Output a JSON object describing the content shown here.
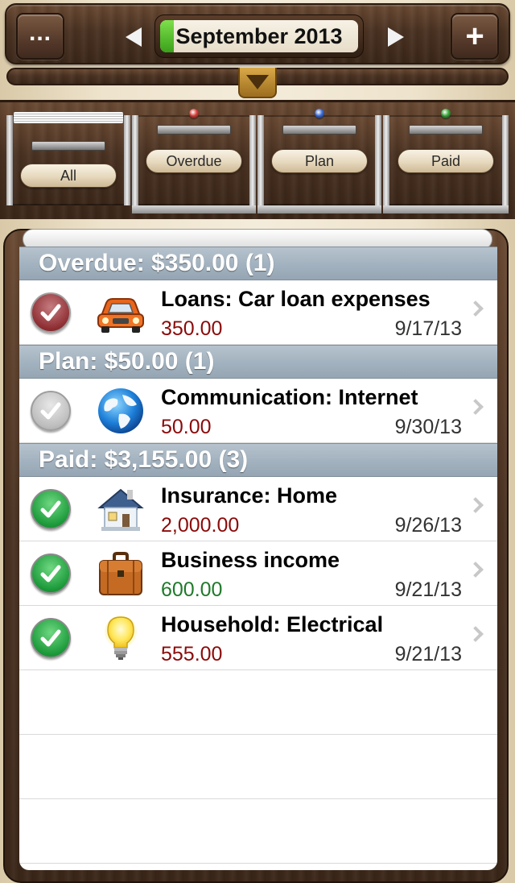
{
  "header": {
    "more_label": "...",
    "add_label": "+",
    "month": "September 2013",
    "month_progress": 0.07
  },
  "drawers": [
    {
      "label": "All",
      "dot_color": null
    },
    {
      "label": "Overdue",
      "dot_color": "#d8403a"
    },
    {
      "label": "Plan",
      "dot_color": "#3a6ad8"
    },
    {
      "label": "Paid",
      "dot_color": "#3aa83a"
    }
  ],
  "colors": {
    "expense_amount": "#8b0a0a",
    "income_amount": "#1f7a2a"
  },
  "sections": [
    {
      "header": "Overdue: $350.00 (1)",
      "items": [
        {
          "title": "Loans: Car loan expenses",
          "amount": "350.00",
          "amount_type": "expense",
          "date": "9/17/13",
          "status": "overdue",
          "icon": "car-icon"
        }
      ]
    },
    {
      "header": "Plan: $50.00 (1)",
      "items": [
        {
          "title": "Communication: Internet",
          "amount": "50.00",
          "amount_type": "expense",
          "date": "9/30/13",
          "status": "plan",
          "icon": "globe-icon"
        }
      ]
    },
    {
      "header": "Paid: $3,155.00 (3)",
      "items": [
        {
          "title": "Insurance: Home",
          "amount": "2,000.00",
          "amount_type": "expense",
          "date": "9/26/13",
          "status": "paid",
          "icon": "house-icon"
        },
        {
          "title": "Business income",
          "amount": "600.00",
          "amount_type": "income",
          "date": "9/21/13",
          "status": "paid",
          "icon": "briefcase-icon"
        },
        {
          "title": "Household: Electrical",
          "amount": "555.00",
          "amount_type": "expense",
          "date": "9/21/13",
          "status": "paid",
          "icon": "lightbulb-icon"
        }
      ]
    }
  ]
}
